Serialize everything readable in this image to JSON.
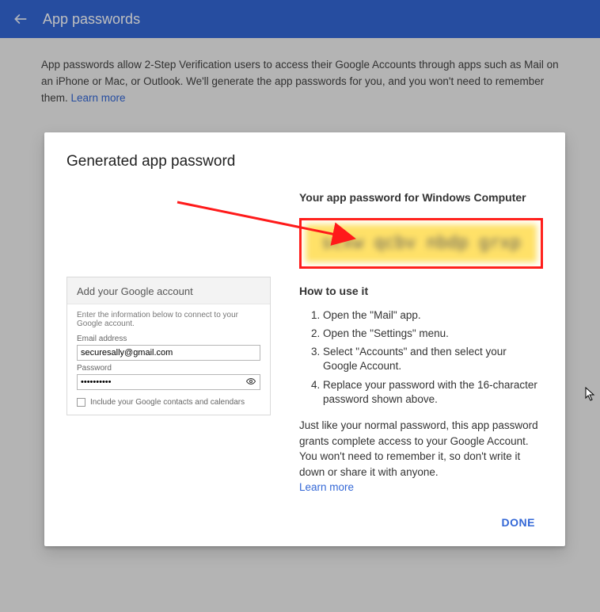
{
  "topbar": {
    "title": "App passwords"
  },
  "intro": {
    "text": "App passwords allow 2-Step Verification users to access their Google Accounts through apps such as Mail on an iPhone or Mac, or Outlook. We'll generate the app passwords for you, and you won't need to remember them. ",
    "learn_more": "Learn more"
  },
  "card": {
    "title": "Generated app password",
    "pw_for": "Your app password for Windows Computer",
    "generated_password": "scxw qcbv nbdp grxp",
    "how_title": "How to use it",
    "steps": [
      "Open the \"Mail\" app.",
      "Open the \"Settings\" menu.",
      "Select \"Accounts\" and then select your Google Account.",
      "Replace your password with the 16-character password shown above."
    ],
    "note": "Just like your normal password, this app password grants complete access to your Google Account. You won't need to remember it, so don't write it down or share it with anyone. ",
    "learn_more": "Learn more",
    "done": "DONE"
  },
  "add_account": {
    "title": "Add your Google account",
    "sub": "Enter the information below to connect to your Google account.",
    "email_label": "Email address",
    "email_value": "securesally@gmail.com",
    "password_label": "Password",
    "password_value": "••••••••••",
    "checkbox_label": "Include your Google contacts and calendars"
  }
}
